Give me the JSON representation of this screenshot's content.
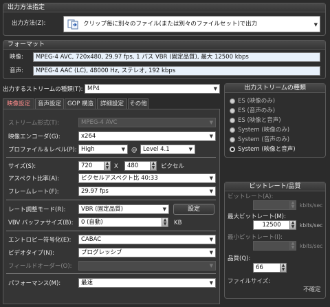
{
  "output_method": {
    "group_title": "出力方法指定",
    "label": "出力方法(Z):",
    "value": "クリップ毎に別々のファイル(または別々のファイルセット)で出力"
  },
  "format": {
    "group_title": "フォーマット",
    "video_label": "映像:",
    "video_value": "MPEG-4 AVC, 720x480, 29.97 fps, 1 パス VBR (固定品質), 最大 12500 kbps",
    "audio_label": "音声:",
    "audio_value": "MPEG-4 AAC (LC), 48000 Hz, ステレオ, 192 kbps"
  },
  "stream_type_select": {
    "label": "出力するストリームの種類(T):",
    "value": "MP4"
  },
  "tabs": [
    {
      "label": "映像設定"
    },
    {
      "label": "音声設定"
    },
    {
      "label": "GOP 構造"
    },
    {
      "label": "詳細設定"
    },
    {
      "label": "その他"
    }
  ],
  "video": {
    "stream_format_label": "ストリーム形式(T):",
    "stream_format_value": "MPEG-4 AVC",
    "encoder_label": "映像エンコーダ(G):",
    "encoder_value": "x264",
    "profile_label": "プロファイル＆レベル(P):",
    "profile_value": "High",
    "at_symbol": "@",
    "level_value": "Level 4.1",
    "size_label": "サイズ(S):",
    "width_value": "720",
    "times_symbol": "X",
    "height_value": "480",
    "pixel_unit": "ピクセル",
    "aspect_label": "アスペクト比率(A):",
    "aspect_value": "ピクセルアスペクト比 40:33",
    "framerate_label": "フレームレート(F):",
    "framerate_value": "29.97 fps",
    "rate_mode_label": "レート調整モード(R):",
    "rate_mode_value": "VBR (固定品質)",
    "settings_button": "設定",
    "vbv_label": "VBV バッファサイズ(B):",
    "vbv_value": "0 (自動)",
    "vbv_unit": "KB",
    "entropy_label": "エントロピー符号化(E):",
    "entropy_value": "CABAC",
    "video_type_label": "ビデオタイプ(N):",
    "video_type_value": "プログレッシブ",
    "field_order_label": "フィールドオーダー(O):",
    "field_order_value": "",
    "performance_label": "パフォーマンス(M):",
    "performance_value": "最速"
  },
  "stream_kind": {
    "title": "出力ストリームの種類",
    "options": [
      {
        "label": "ES (映像のみ)",
        "selected": false
      },
      {
        "label": "ES (音声のみ)",
        "selected": false
      },
      {
        "label": "ES (映像と音声)",
        "selected": false
      },
      {
        "label": "System (映像のみ)",
        "selected": false
      },
      {
        "label": "System (音声のみ)",
        "selected": false
      },
      {
        "label": "System (映像と音声)",
        "selected": true
      }
    ]
  },
  "bitrate": {
    "title": "ビットレート/品質",
    "bitrate_label": "ビットレート(A):",
    "bitrate_value": "",
    "unit": "kbits/sec",
    "max_label": "最大ビットレート(M):",
    "max_value": "12500",
    "min_label": "最小ビットレート(I):",
    "min_value": "",
    "quality_label": "品質(Q):",
    "quality_value": "66",
    "filesize_label": "ファイルサイズ:",
    "filesize_value": "不確定"
  },
  "colors": {
    "background": "#2b2b2b",
    "active_tab_text": "#ff8c8c",
    "field_bg": "#ffffff"
  }
}
